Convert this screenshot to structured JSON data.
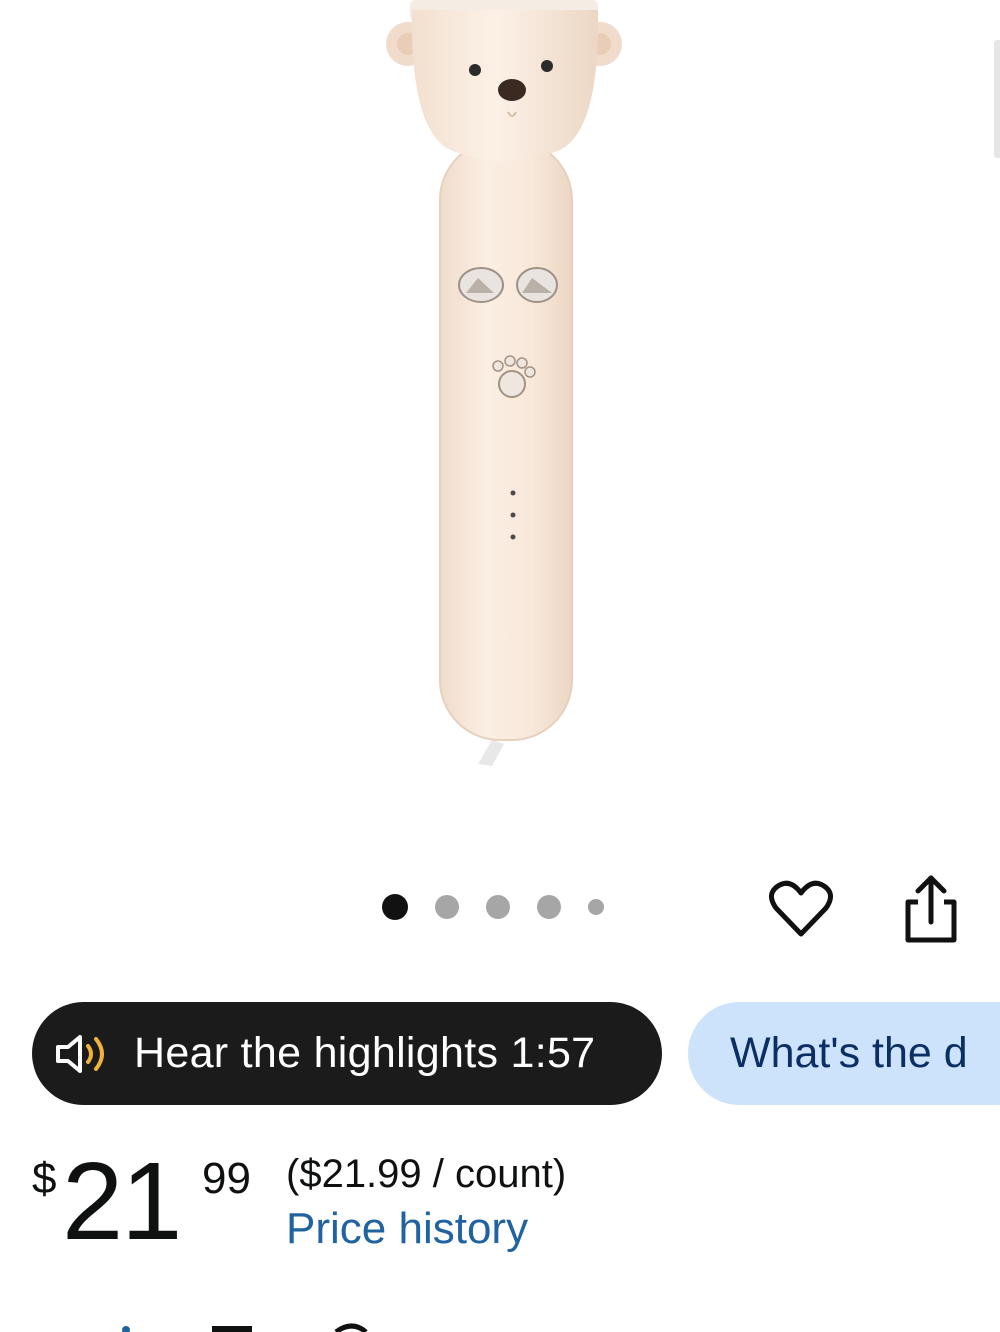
{
  "gallery": {
    "image_alt": "Cream bear-head handheld fan",
    "dot_count": 5,
    "active_index": 0
  },
  "actions": {
    "wishlist_icon": "heart-icon",
    "share_icon": "share-icon"
  },
  "chips": {
    "hear": {
      "icon": "speaker-icon",
      "label": "Hear the highlights 1:57"
    },
    "whats": {
      "label": "What's the d"
    }
  },
  "price": {
    "symbol": "$",
    "whole": "21",
    "fraction": "99",
    "unit": "($21.99 / count)",
    "history_link": "Price history"
  },
  "colors": {
    "hear_chip_bg": "#1b1b1b",
    "speaker_accent": "#f0b23a",
    "whats_chip_bg": "#cde3fb",
    "whats_chip_text": "#0b2f64",
    "link": "#2162a1"
  }
}
